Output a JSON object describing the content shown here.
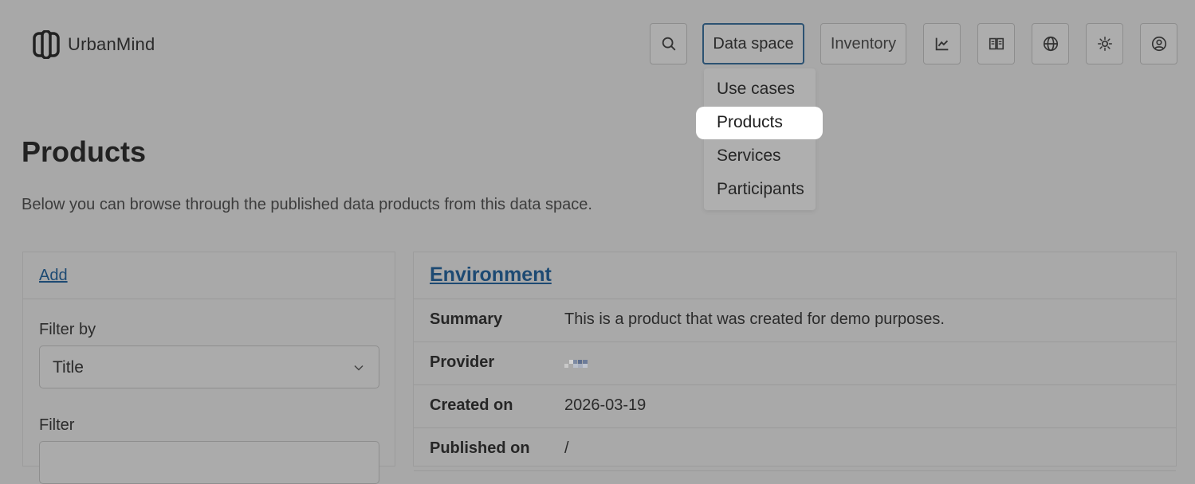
{
  "brand": {
    "name": "UrbanMind"
  },
  "nav": {
    "search_icon": "search-icon",
    "data_space_label": "Data space",
    "inventory_label": "Inventory",
    "icons": [
      "chart-icon",
      "book-icon",
      "globe-icon",
      "sun-icon",
      "user-icon"
    ]
  },
  "dropdown": {
    "items": [
      "Use cases",
      "Products",
      "Services",
      "Participants"
    ],
    "highlighted": "Products"
  },
  "page": {
    "title": "Products",
    "subtitle": "Below you can browse through the published data products from this data space."
  },
  "left_panel": {
    "add_label": "Add",
    "filter_by_label": "Filter by",
    "filter_by_value": "Title",
    "filter_label": "Filter"
  },
  "product": {
    "title": "Environment",
    "rows": [
      {
        "key": "Summary",
        "value": "This is a product that was created for demo purposes."
      },
      {
        "key": "Provider",
        "value": ""
      },
      {
        "key": "Created on",
        "value": "2026-03-19"
      },
      {
        "key": "Published on",
        "value": "/"
      }
    ]
  }
}
